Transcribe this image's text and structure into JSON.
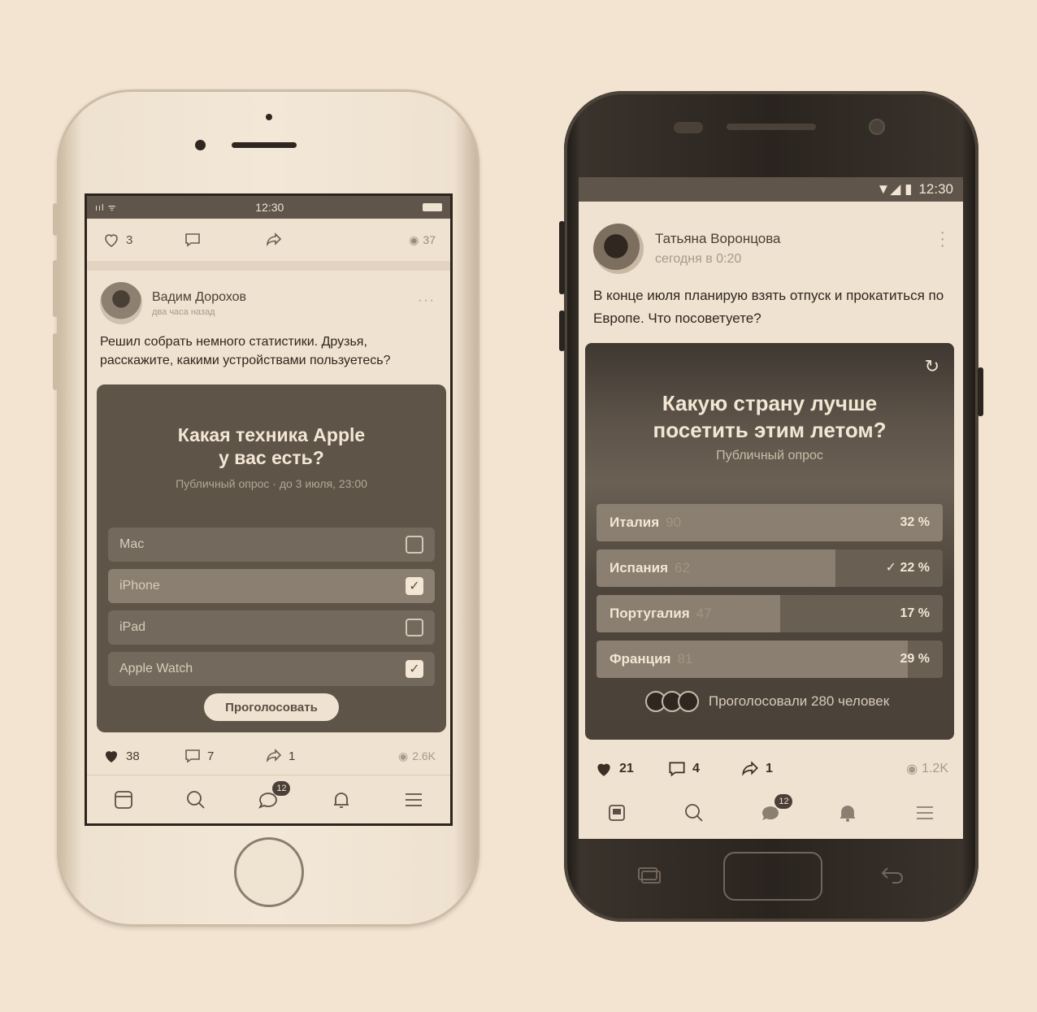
{
  "iphone": {
    "status": {
      "signal": "ııl ᯤ",
      "time": "12:30"
    },
    "prev_post": {
      "likes": "3",
      "views": "37"
    },
    "post": {
      "author": "Вадим Дорохов",
      "time": "два часа назад",
      "more": "···",
      "text": "Решил собрать немного статистики. Друзья, расскажите, какими устройствами пользуетесь?"
    },
    "poll": {
      "title_line1": "Какая техника Apple",
      "title_line2": "у вас есть?",
      "subtitle": "Публичный опрос · до 3 июля, 23:00",
      "options": [
        {
          "label": "Mac",
          "checked": false
        },
        {
          "label": "iPhone",
          "checked": true
        },
        {
          "label": "iPad",
          "checked": false
        },
        {
          "label": "Apple Watch",
          "checked": true
        }
      ],
      "check_mark": "✓",
      "vote_button": "Проголосовать"
    },
    "stats": {
      "likes": "38",
      "comments": "7",
      "shares": "1",
      "views": "2.6K"
    },
    "tabbar": {
      "messages_badge": "12"
    }
  },
  "android": {
    "status": {
      "icons": "▼◢ ▮",
      "time": "12:30"
    },
    "post": {
      "author": "Татьяна Воронцова",
      "time": "сегодня в 0:20",
      "text": "В конце июля планирую взять отпуск и прокатиться по Европе. Что посоветуете?"
    },
    "poll": {
      "refresh": "↻",
      "title_line1": "Какую страну лучше",
      "title_line2": "посетить этим летом?",
      "subtitle": "Публичный опрос",
      "results": [
        {
          "label": "Италия",
          "count": "90",
          "percent": "32 %",
          "share": 1.0,
          "mine": false
        },
        {
          "label": "Испания",
          "count": "62",
          "percent": "✓ 22 %",
          "share": 0.69,
          "mine": true
        },
        {
          "label": "Португалия",
          "count": "47",
          "percent": "17 %",
          "share": 0.53,
          "mine": false
        },
        {
          "label": "Франция",
          "count": "81",
          "percent": "29 %",
          "share": 0.9,
          "mine": false
        }
      ],
      "voters_text": "Проголосовали 280 человек"
    },
    "stats": {
      "likes": "21",
      "comments": "4",
      "shares": "1",
      "views": "1.2K"
    },
    "tabbar": {
      "messages_badge": "12"
    }
  },
  "colors": {
    "background": "#f3e4d1",
    "poll_dark": "#5e5448",
    "accent": "#3a2f25"
  }
}
